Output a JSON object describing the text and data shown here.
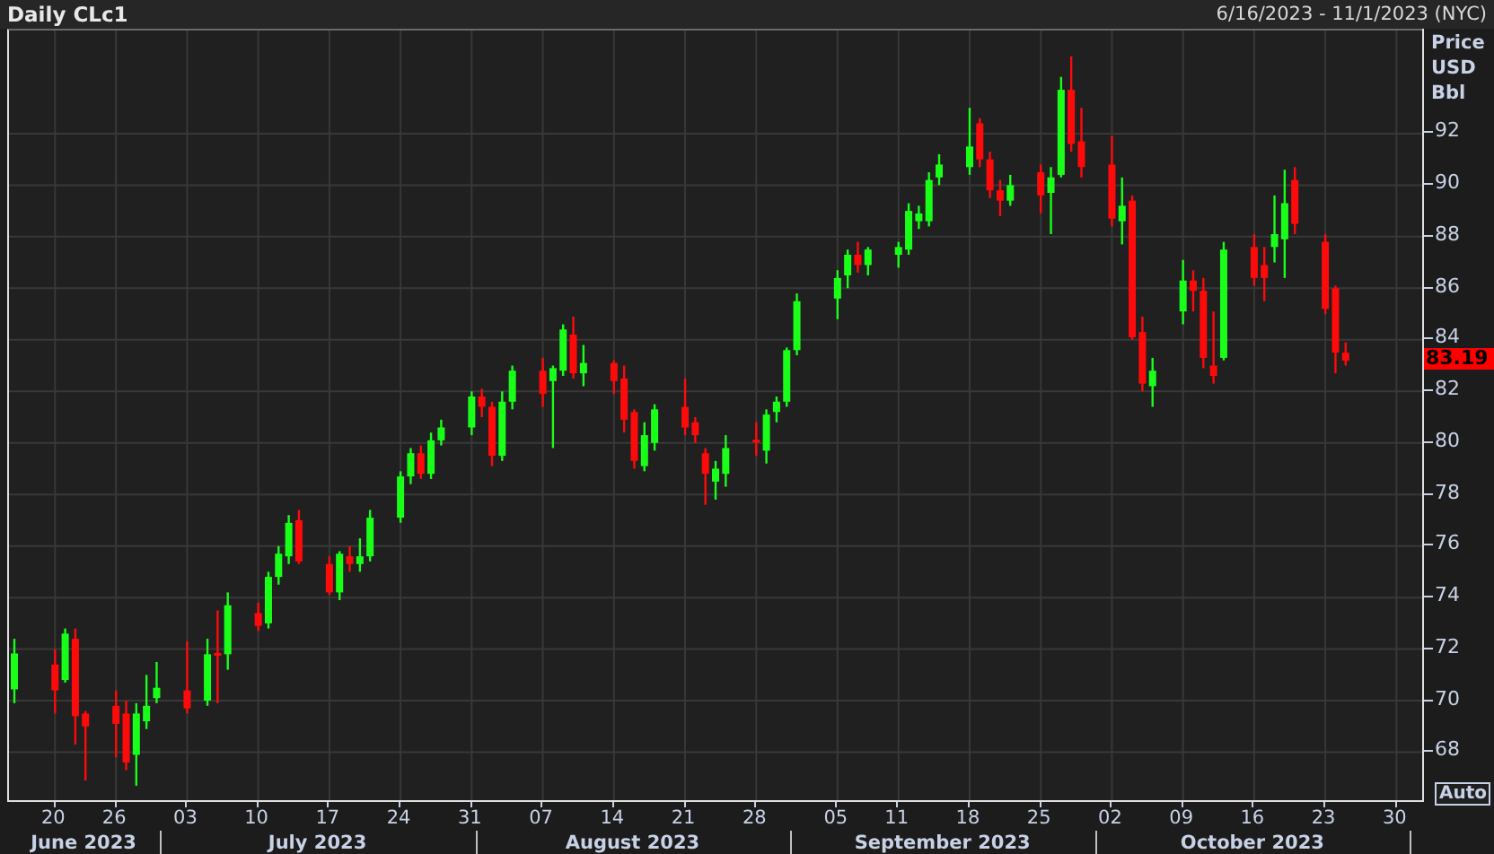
{
  "header": {
    "title": "Daily CLc1",
    "range": "6/16/2023 - 11/1/2023 (NYC)"
  },
  "axis_title": [
    "Price",
    "USD",
    "Bbl"
  ],
  "auto_button": "Auto",
  "months": [
    "June 2023",
    "July 2023",
    "August 2023",
    "September 2023",
    "October 2023"
  ],
  "chart_data": {
    "type": "candlestick",
    "x": [
      "2023-06-16",
      "2023-06-20",
      "2023-06-21",
      "2023-06-22",
      "2023-06-23",
      "2023-06-26",
      "2023-06-27",
      "2023-06-28",
      "2023-06-29",
      "2023-06-30",
      "2023-07-03",
      "2023-07-05",
      "2023-07-06",
      "2023-07-07",
      "2023-07-10",
      "2023-07-11",
      "2023-07-12",
      "2023-07-13",
      "2023-07-14",
      "2023-07-17",
      "2023-07-18",
      "2023-07-19",
      "2023-07-20",
      "2023-07-21",
      "2023-07-24",
      "2023-07-25",
      "2023-07-26",
      "2023-07-27",
      "2023-07-28",
      "2023-07-31",
      "2023-08-01",
      "2023-08-02",
      "2023-08-03",
      "2023-08-04",
      "2023-08-07",
      "2023-08-08",
      "2023-08-09",
      "2023-08-10",
      "2023-08-11",
      "2023-08-14",
      "2023-08-15",
      "2023-08-16",
      "2023-08-17",
      "2023-08-18",
      "2023-08-21",
      "2023-08-22",
      "2023-08-23",
      "2023-08-24",
      "2023-08-25",
      "2023-08-28",
      "2023-08-29",
      "2023-08-30",
      "2023-08-31",
      "2023-09-01",
      "2023-09-05",
      "2023-09-06",
      "2023-09-07",
      "2023-09-08",
      "2023-09-11",
      "2023-09-12",
      "2023-09-13",
      "2023-09-14",
      "2023-09-15",
      "2023-09-18",
      "2023-09-19",
      "2023-09-20",
      "2023-09-21",
      "2023-09-22",
      "2023-09-25",
      "2023-09-26",
      "2023-09-27",
      "2023-09-28",
      "2023-09-29",
      "2023-10-02",
      "2023-10-03",
      "2023-10-04",
      "2023-10-05",
      "2023-10-06",
      "2023-10-09",
      "2023-10-10",
      "2023-10-11",
      "2023-10-12",
      "2023-10-13",
      "2023-10-16",
      "2023-10-17",
      "2023-10-18",
      "2023-10-19",
      "2023-10-20",
      "2023-10-23",
      "2023-10-24",
      "2023-10-25"
    ],
    "ohlc": [
      [
        70.44,
        72.4,
        69.9,
        71.83
      ],
      [
        71.4,
        72.0,
        69.5,
        70.4
      ],
      [
        70.8,
        72.8,
        70.7,
        72.6
      ],
      [
        72.4,
        72.8,
        68.3,
        69.4
      ],
      [
        69.5,
        69.6,
        66.9,
        69.0
      ],
      [
        69.8,
        70.4,
        67.8,
        69.1
      ],
      [
        69.5,
        70.0,
        67.3,
        67.6
      ],
      [
        67.9,
        69.9,
        66.7,
        69.5
      ],
      [
        69.2,
        71.0,
        68.9,
        69.8
      ],
      [
        70.1,
        71.5,
        69.9,
        70.5
      ],
      [
        70.4,
        72.3,
        69.5,
        69.7
      ],
      [
        70.0,
        72.4,
        69.8,
        71.8
      ],
      [
        71.85,
        73.5,
        69.9,
        71.8
      ],
      [
        71.8,
        74.2,
        71.2,
        73.7
      ],
      [
        73.4,
        73.8,
        72.7,
        72.9
      ],
      [
        73.0,
        75.0,
        72.8,
        74.8
      ],
      [
        74.8,
        76.0,
        74.5,
        75.7
      ],
      [
        75.6,
        77.2,
        75.3,
        76.9
      ],
      [
        77.0,
        77.4,
        75.3,
        75.4
      ],
      [
        75.3,
        75.6,
        74.1,
        74.2
      ],
      [
        74.2,
        75.8,
        73.9,
        75.7
      ],
      [
        75.6,
        76.0,
        75.0,
        75.3
      ],
      [
        75.3,
        76.3,
        75.0,
        75.6
      ],
      [
        75.6,
        77.4,
        75.4,
        77.1
      ],
      [
        77.1,
        78.9,
        76.9,
        78.7
      ],
      [
        78.7,
        79.8,
        78.4,
        79.6
      ],
      [
        79.6,
        79.9,
        78.6,
        78.8
      ],
      [
        78.8,
        80.4,
        78.6,
        80.1
      ],
      [
        80.1,
        80.9,
        79.9,
        80.6
      ],
      [
        80.6,
        82.0,
        80.3,
        81.8
      ],
      [
        81.8,
        82.1,
        81.0,
        81.4
      ],
      [
        81.4,
        81.6,
        79.1,
        79.5
      ],
      [
        79.5,
        82.0,
        79.3,
        81.6
      ],
      [
        81.6,
        83.0,
        81.3,
        82.8
      ],
      [
        82.8,
        83.3,
        81.4,
        81.9
      ],
      [
        82.4,
        83.0,
        79.8,
        82.9
      ],
      [
        82.8,
        84.6,
        82.6,
        84.4
      ],
      [
        84.2,
        84.9,
        82.5,
        82.7
      ],
      [
        82.7,
        83.8,
        82.2,
        83.1
      ],
      [
        83.1,
        83.2,
        81.9,
        82.4
      ],
      [
        82.5,
        83.0,
        80.4,
        80.9
      ],
      [
        81.2,
        81.3,
        79.0,
        79.3
      ],
      [
        79.1,
        80.8,
        78.9,
        80.3
      ],
      [
        80.0,
        81.5,
        79.7,
        81.3
      ],
      [
        81.4,
        82.5,
        80.3,
        80.6
      ],
      [
        80.8,
        81.0,
        80.0,
        80.3
      ],
      [
        79.6,
        79.8,
        77.6,
        78.8
      ],
      [
        78.5,
        79.3,
        77.8,
        79.0
      ],
      [
        78.8,
        80.3,
        78.3,
        79.8
      ],
      [
        80.12,
        80.8,
        79.5,
        80.08
      ],
      [
        79.7,
        81.3,
        79.2,
        81.1
      ],
      [
        81.2,
        81.8,
        80.8,
        81.6
      ],
      [
        81.6,
        83.7,
        81.4,
        83.6
      ],
      [
        83.6,
        85.8,
        83.4,
        85.5
      ],
      [
        85.6,
        86.7,
        84.8,
        86.4
      ],
      [
        86.5,
        87.5,
        86.0,
        87.3
      ],
      [
        87.3,
        87.8,
        86.6,
        86.9
      ],
      [
        86.9,
        87.6,
        86.5,
        87.5
      ],
      [
        87.3,
        87.8,
        86.8,
        87.6
      ],
      [
        87.5,
        89.3,
        87.3,
        89.0
      ],
      [
        88.6,
        89.2,
        88.3,
        88.9
      ],
      [
        88.6,
        90.5,
        88.4,
        90.2
      ],
      [
        90.3,
        91.2,
        90.0,
        90.8
      ],
      [
        90.7,
        93.0,
        90.4,
        91.5
      ],
      [
        92.4,
        92.6,
        90.7,
        91.0
      ],
      [
        91.0,
        91.3,
        89.5,
        89.8
      ],
      [
        89.8,
        90.2,
        88.8,
        89.4
      ],
      [
        89.4,
        90.4,
        89.2,
        90.0
      ],
      [
        90.5,
        90.8,
        88.9,
        89.6
      ],
      [
        89.7,
        90.7,
        88.1,
        90.3
      ],
      [
        90.4,
        94.2,
        90.3,
        93.7
      ],
      [
        93.7,
        95.0,
        91.3,
        91.6
      ],
      [
        91.7,
        93.0,
        90.3,
        90.7
      ],
      [
        90.8,
        91.9,
        88.4,
        88.7
      ],
      [
        88.6,
        90.3,
        87.7,
        89.2
      ],
      [
        89.4,
        89.6,
        84.0,
        84.1
      ],
      [
        84.3,
        84.9,
        82.0,
        82.3
      ],
      [
        82.2,
        83.3,
        81.4,
        82.8
      ],
      [
        85.1,
        87.1,
        84.6,
        86.3
      ],
      [
        86.3,
        86.7,
        85.1,
        85.9
      ],
      [
        85.9,
        86.4,
        82.9,
        83.3
      ],
      [
        83.0,
        85.1,
        82.3,
        82.6
      ],
      [
        83.3,
        87.8,
        83.2,
        87.5
      ],
      [
        87.6,
        88.1,
        86.1,
        86.4
      ],
      [
        86.9,
        87.6,
        85.5,
        86.4
      ],
      [
        87.6,
        89.6,
        87.0,
        88.1
      ],
      [
        87.9,
        90.6,
        86.4,
        89.3
      ],
      [
        90.2,
        90.7,
        88.1,
        88.5
      ],
      [
        87.8,
        88.1,
        85.0,
        85.2
      ],
      [
        86.0,
        86.1,
        82.7,
        83.5
      ],
      [
        83.5,
        83.9,
        83.0,
        83.19
      ]
    ],
    "xlim": [
      "2023-06-16",
      "2023-11-01"
    ],
    "ylim": [
      66,
      96
    ],
    "xticks": [
      {
        "value": "2023-06-20",
        "label": "20"
      },
      {
        "value": "2023-06-26",
        "label": "26"
      },
      {
        "value": "2023-07-03",
        "label": "03"
      },
      {
        "value": "2023-07-10",
        "label": "10"
      },
      {
        "value": "2023-07-17",
        "label": "17"
      },
      {
        "value": "2023-07-24",
        "label": "24"
      },
      {
        "value": "2023-07-31",
        "label": "31"
      },
      {
        "value": "2023-08-07",
        "label": "07"
      },
      {
        "value": "2023-08-14",
        "label": "14"
      },
      {
        "value": "2023-08-21",
        "label": "21"
      },
      {
        "value": "2023-08-28",
        "label": "28"
      },
      {
        "value": "2023-09-05",
        "label": "05"
      },
      {
        "value": "2023-09-11",
        "label": "11"
      },
      {
        "value": "2023-09-18",
        "label": "18"
      },
      {
        "value": "2023-09-25",
        "label": "25"
      },
      {
        "value": "2023-10-02",
        "label": "02"
      },
      {
        "value": "2023-10-09",
        "label": "09"
      },
      {
        "value": "2023-10-16",
        "label": "16"
      },
      {
        "value": "2023-10-23",
        "label": "23"
      },
      {
        "value": "2023-10-30",
        "label": "30"
      }
    ],
    "yticks": [
      68,
      70,
      72,
      74,
      76,
      78,
      80,
      82,
      84,
      86,
      88,
      90,
      92
    ],
    "annotations": [
      "83.19"
    ],
    "grid": true
  }
}
